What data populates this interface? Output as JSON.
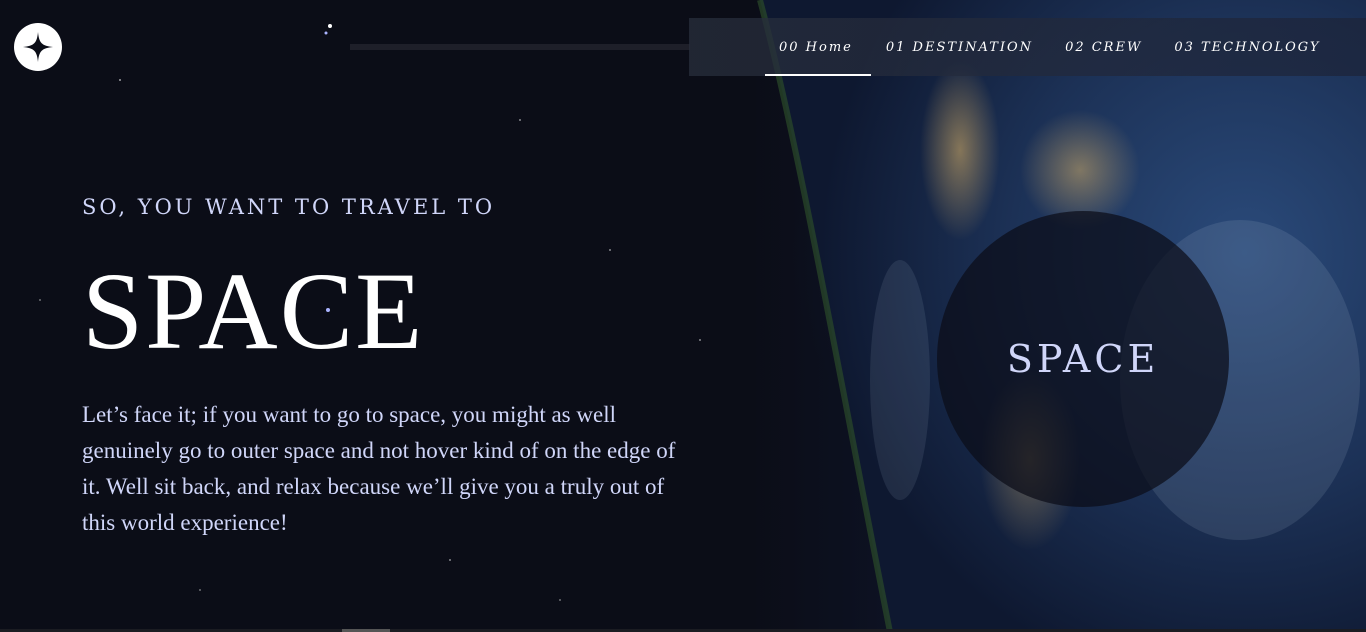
{
  "nav": {
    "items": [
      {
        "label": "00 Home",
        "active": true
      },
      {
        "label": "01 DESTINATION",
        "active": false
      },
      {
        "label": "02 CREW",
        "active": false
      },
      {
        "label": "03 TECHNOLOGY",
        "active": false
      }
    ]
  },
  "hero": {
    "eyebrow": "SO, YOU WANT TO TRAVEL TO",
    "title": "SPACE",
    "body": "Let’s face it; if you want to go to space, you might as well genuinely go to outer space and not hover kind of on the edge of it. Well sit back, and relax because we’ll give you a truly out of this world experience!"
  },
  "explore_button": {
    "label": "SPACE"
  },
  "icons": {
    "logo": "star-logo-icon"
  },
  "colors": {
    "background": "#0b0d17",
    "text_light": "#d0d6f9",
    "white": "#ffffff"
  }
}
